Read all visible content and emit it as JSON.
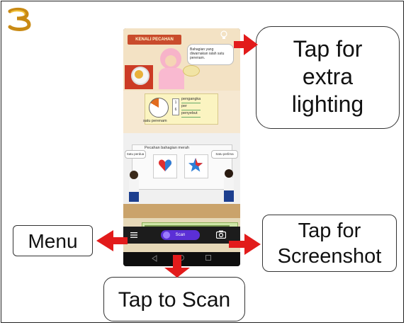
{
  "colors": {
    "arrow": "#e21b1b",
    "scan_button": "#5b2fd6",
    "app_bar": "#1c1c1c"
  },
  "icons": {
    "logo": "brand-logo-3",
    "light": "light-bulb-icon",
    "menu": "hamburger-menu-icon",
    "camera": "camera-icon",
    "scan": "scan-icon"
  },
  "app": {
    "book": {
      "banner": "KENALI PECAHAN",
      "bubble": "Bahagian yang diwarnakan ialah satu perenam.",
      "fraction_top": "1",
      "fraction_bottom": "6",
      "fraction_labels": [
        "pengangka",
        "per",
        "penyebut"
      ],
      "fraction_caption": "satu perenam",
      "scene_title": "Pecahan bahagian merah",
      "bubble_left": "Satu perdua",
      "bubble_right": "Satu perlima"
    },
    "scan_button": "Scan"
  },
  "callouts": {
    "light": [
      "Tap for",
      "extra",
      "lighting"
    ],
    "menu": "Menu",
    "screenshot": [
      "Tap for",
      "Screenshot"
    ],
    "scan": "Tap to Scan"
  }
}
